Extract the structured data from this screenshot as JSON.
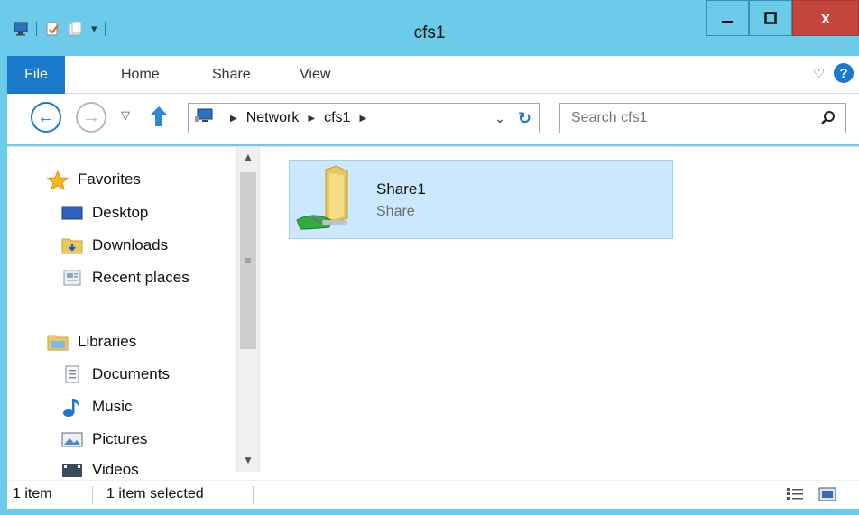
{
  "window": {
    "title": "cfs1",
    "controls": {
      "minimize": "_",
      "maximize": "□",
      "close": "x"
    }
  },
  "ribbon": {
    "tabs": [
      "File",
      "Home",
      "Share",
      "View"
    ],
    "help": "?"
  },
  "navigation": {
    "breadcrumb": [
      "Network",
      "cfs1"
    ],
    "search_placeholder": "Search cfs1"
  },
  "sidebar": {
    "favorites": {
      "label": "Favorites",
      "items": [
        "Desktop",
        "Downloads",
        "Recent places"
      ]
    },
    "libraries": {
      "label": "Libraries",
      "items": [
        "Documents",
        "Music",
        "Pictures",
        "Videos"
      ]
    }
  },
  "files": [
    {
      "name": "Share1",
      "type": "Share",
      "selected": true
    }
  ],
  "status": {
    "count": "1 item",
    "selected": "1 item selected"
  },
  "colors": {
    "titlebar": "#6bcbe8",
    "accent": "#1979ca",
    "close": "#c4453c",
    "selection": "#cce8ff"
  }
}
